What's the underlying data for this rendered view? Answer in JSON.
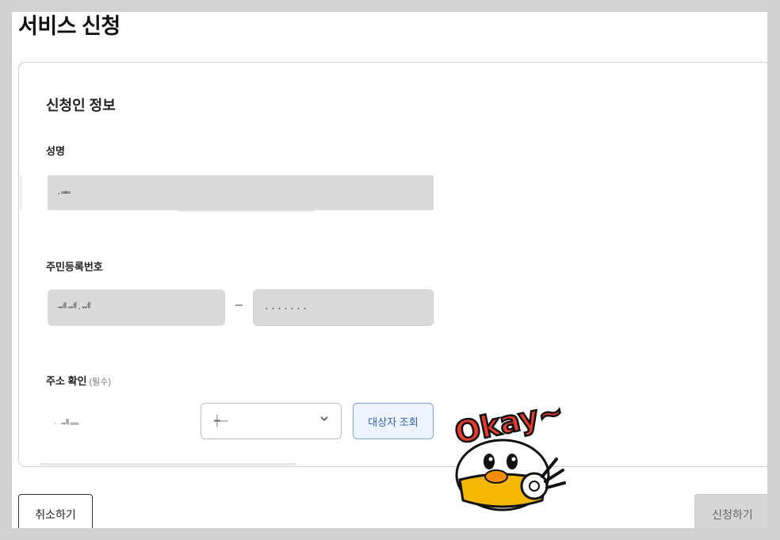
{
  "page": {
    "title": "서비스 신청"
  },
  "applicant": {
    "section_title": "신청인 정보",
    "name": {
      "label": "성명",
      "value": "·ᆂ"
    },
    "rrn": {
      "label": "주민등록번호",
      "front_value": "ᆐᆐ·ᆐ",
      "separator": "–",
      "back_value": "·······"
    },
    "address": {
      "label": "주소 확인",
      "required_mark": "(필수)",
      "input_value": "ᆞᆒᆖ",
      "select_value": "┿─",
      "lookup_label": "대상자 조회"
    }
  },
  "sticker": {
    "text": "Okay~"
  },
  "footer": {
    "cancel_label": "취소하기",
    "submit_label": "신청하기"
  },
  "colors": {
    "accent": "#2f5fb3",
    "disabled": "#d6d6d6"
  }
}
